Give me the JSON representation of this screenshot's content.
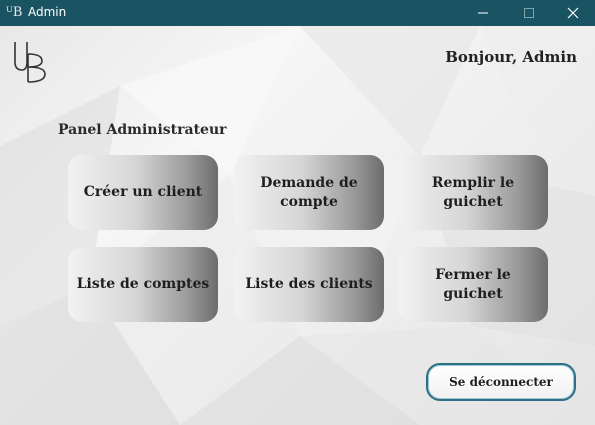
{
  "window": {
    "title": "Admin",
    "icon": "ub-logo-icon",
    "controls": [
      "minimize-icon",
      "maximize-icon",
      "close-icon"
    ]
  },
  "header": {
    "logo_text": "UB",
    "greeting": "Bonjour, Admin"
  },
  "panel": {
    "title": "Panel Administrateur",
    "buttons": [
      {
        "label": "Créer un client"
      },
      {
        "label": "Demande de compte"
      },
      {
        "label": "Remplir le guichet"
      },
      {
        "label": "Liste de comptes"
      },
      {
        "label": "Liste des clients"
      },
      {
        "label": "Fermer le guichet"
      }
    ]
  },
  "footer": {
    "logout_label": "Se déconnecter"
  },
  "colors": {
    "titlebar": "#1a5463",
    "logout_border": "#2e6e86"
  }
}
